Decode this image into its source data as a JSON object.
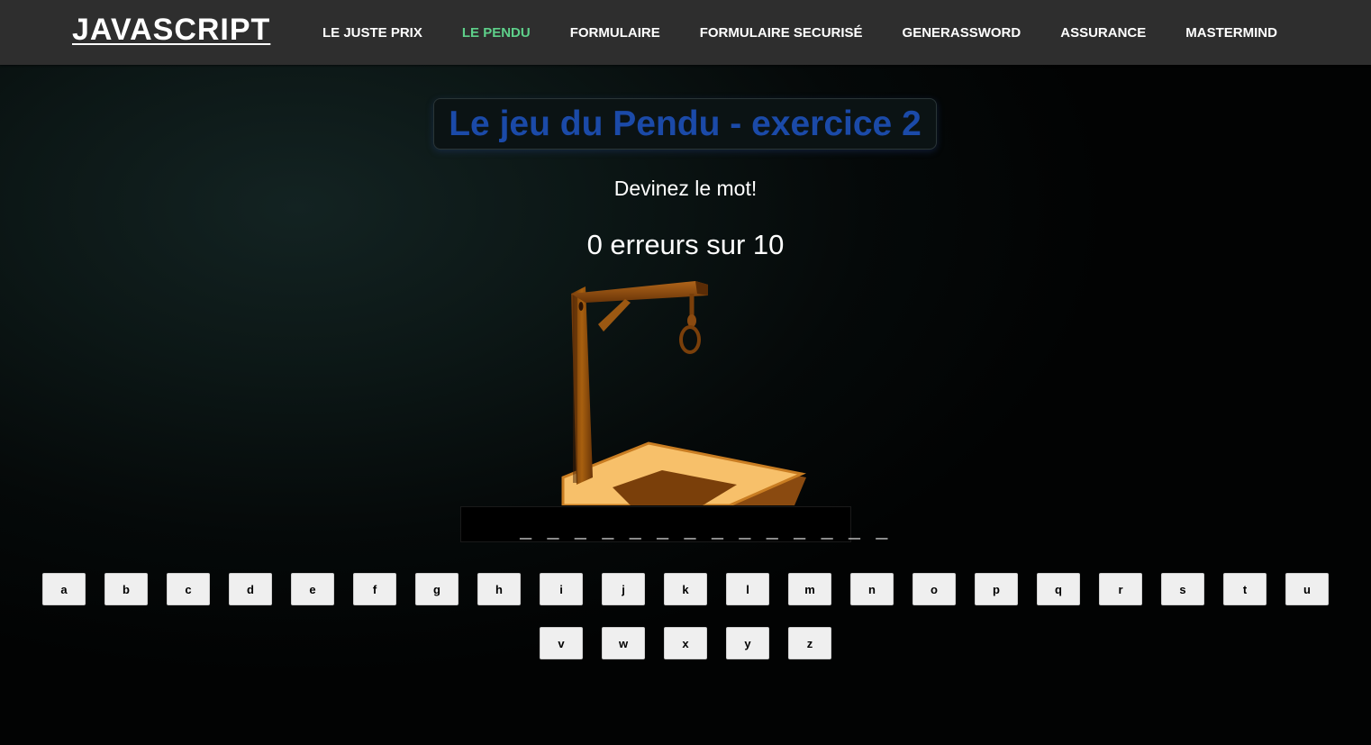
{
  "navbar": {
    "brand": "JAVASCRIPT",
    "links": [
      {
        "label": "LE JUSTE PRIX",
        "active": false
      },
      {
        "label": "LE PENDU",
        "active": true
      },
      {
        "label": "FORMULAIRE",
        "active": false
      },
      {
        "label": "FORMULAIRE SECURISÉ",
        "active": false
      },
      {
        "label": "GENERASSWORD",
        "active": false
      },
      {
        "label": "ASSURANCE",
        "active": false
      },
      {
        "label": "MASTERMIND",
        "active": false
      }
    ]
  },
  "game": {
    "title": "Le jeu du Pendu - exercice 2",
    "subtitle": "Devinez le mot!",
    "errors_text": "0 erreurs sur 10",
    "errors": 0,
    "max_errors": 10,
    "hidden_word": "_ _ _ _ _ _ _ _ _ _ _ _ _ _"
  },
  "keyboard": {
    "rows": [
      [
        "a",
        "b",
        "c",
        "d",
        "e",
        "f",
        "g",
        "h",
        "i",
        "j",
        "k",
        "l",
        "m",
        "n",
        "o",
        "p",
        "q",
        "r",
        "s",
        "t",
        "u"
      ],
      [
        "v",
        "w",
        "x",
        "y",
        "z"
      ]
    ]
  },
  "colors": {
    "navbar_bg": "#2e2e2e",
    "active_link": "#5ed08a",
    "title": "#1b4aa8",
    "wood_dark": "#7a3f0a",
    "wood_light": "#f7c06a"
  },
  "icons": {
    "gallows": "gallows-icon",
    "cursor": "mouse-cursor-icon"
  }
}
